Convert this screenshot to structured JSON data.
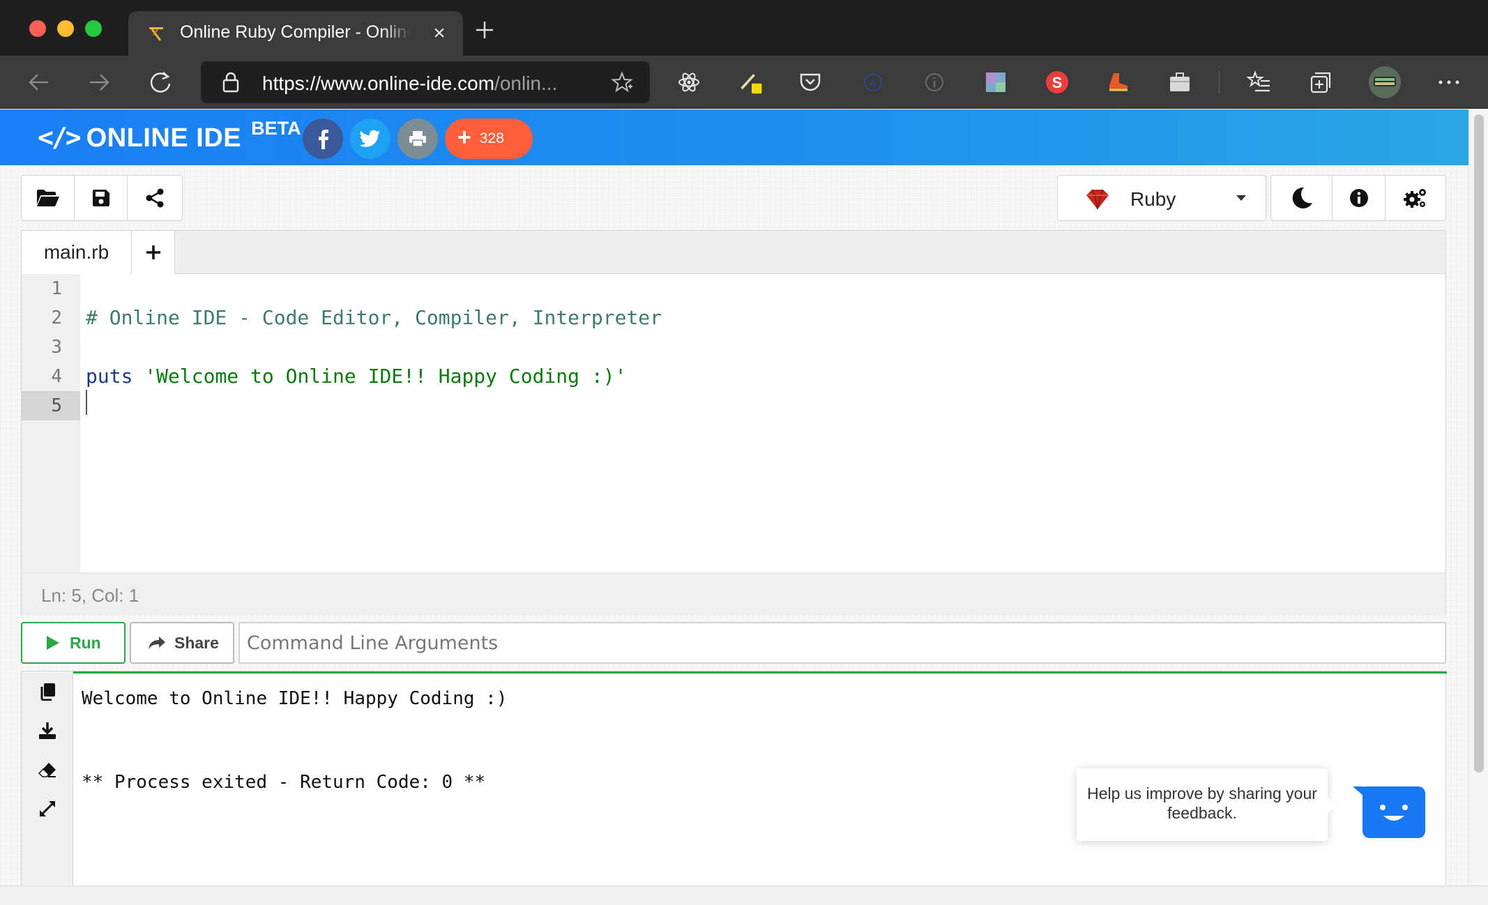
{
  "browser": {
    "tab_title": "Online Ruby Compiler - Online IDE",
    "url_main": "https://www.online-ide.com",
    "url_rest": "/onlin..."
  },
  "site": {
    "logo_mark": "</>",
    "logo_text": "ONLINE IDE",
    "logo_badge": "BETA",
    "share_count": "328"
  },
  "language": {
    "selected": "Ruby"
  },
  "editor": {
    "tabs": [
      {
        "label": "main.rb"
      }
    ],
    "line_numbers": [
      "1",
      "2",
      "3",
      "4",
      "5"
    ],
    "code": {
      "comment": "# Online IDE - Code Editor, Compiler, Interpreter",
      "keyword": "puts",
      "string": "'Welcome to Online IDE!! Happy Coding :)'"
    },
    "status": "Ln: 5,  Col: 1"
  },
  "actions": {
    "run_label": "Run",
    "share_label": "Share",
    "args_placeholder": "Command Line Arguments"
  },
  "output": {
    "lines": [
      "Welcome to Online IDE!! Happy Coding :)",
      "** Process exited - Return Code: 0 **"
    ]
  },
  "feedback": {
    "text": "Help us improve by sharing your feedback."
  },
  "colors": {
    "header_blue": "#1a7ef5",
    "run_green": "#28a745",
    "plus_orange": "#ff5e3a"
  }
}
